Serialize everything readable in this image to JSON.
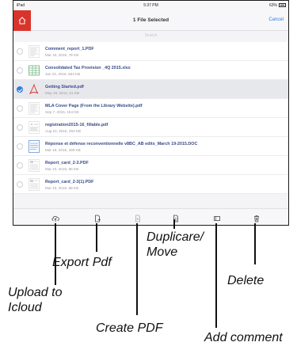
{
  "status": {
    "device": "iPad",
    "time": "5:37 PM",
    "battery": "63%"
  },
  "nav": {
    "title": "1 File Selected",
    "cancel": "Cancel",
    "search_placeholder": "Search"
  },
  "files": [
    {
      "name": "Comment_report_1.PDF",
      "meta": "Mar 10, 2015, 78 KB",
      "type": "pdf-doc",
      "selected": false
    },
    {
      "name": "Consolidated Tax Provision _4Q 2015.xlsx",
      "meta": "Jan 23, 2016, 562 KB",
      "type": "spreadsheet",
      "selected": false
    },
    {
      "name": "Getting Started.pdf",
      "meta": "May 19, 2012, 61 KB",
      "type": "acrobat",
      "selected": true
    },
    {
      "name": "MLA Cover Page (From the Library Website).pdf",
      "meta": "Sep 7, 2015, 154 KB",
      "type": "pdf-doc",
      "selected": false
    },
    {
      "name": "registration2015-16_fillable.pdf",
      "meta": "Aug 10, 2015, 253 KB",
      "type": "form",
      "selected": false
    },
    {
      "name": "Réponse et défense reconventionnelle v8BC_AB edits_March 19-2015.DOC",
      "meta": "Mar 19, 2015, 330 KB",
      "type": "word",
      "selected": false
    },
    {
      "name": "Report_card_2-3.PDF",
      "meta": "Mar 10, 2015, 88 KB",
      "type": "report",
      "selected": false
    },
    {
      "name": "Report_card_2-3(1).PDF",
      "meta": "Mar 10, 2015, 88 KB",
      "type": "report",
      "selected": false
    }
  ],
  "toolbar": {
    "icons": [
      "cloud-upload-icon",
      "export-pdf-icon",
      "create-pdf-icon",
      "duplicate-move-icon",
      "add-comment-icon",
      "trash-icon"
    ]
  },
  "annotations": {
    "upload": "Upload to\nIcloud",
    "export": "Export Pdf",
    "create": "Create PDF",
    "duplicate": "Duplicare/\nMove",
    "comment": "Add comment",
    "delete": "Delete"
  },
  "colors": {
    "accent": "#d9342b",
    "link": "#2f7de1",
    "filename": "#3a4b8a"
  }
}
